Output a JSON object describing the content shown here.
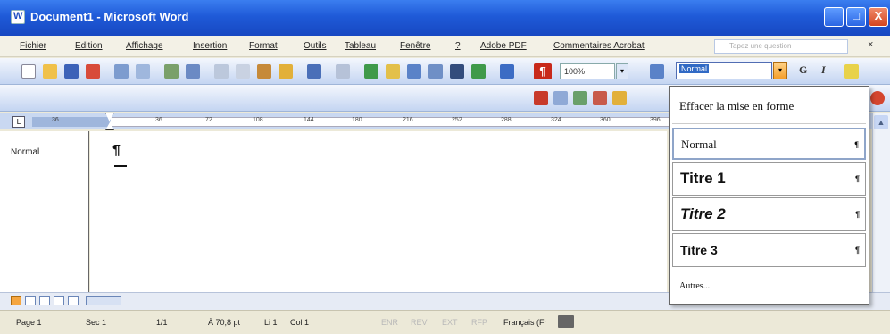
{
  "window": {
    "title": "Document1 - Microsoft Word",
    "minimize_glyph": "_",
    "maximize_glyph": "□",
    "close_glyph": "X"
  },
  "menu": {
    "items": [
      "Fichier",
      "Edition",
      "Affichage",
      "Insertion",
      "Format",
      "Outils",
      "Tableau",
      "Fenêtre",
      "?",
      "Adobe PDF",
      "Commentaires Acrobat"
    ],
    "ask_placeholder": "Tapez une question",
    "ask_close": "×"
  },
  "toolbar": {
    "zoom_value": "100%",
    "zoom_arrow": "▾",
    "pilcrow_button": "¶",
    "style_value": "Normal",
    "style_arrow": "▾",
    "bold_label": "G",
    "italic_label": "I"
  },
  "ruler": {
    "tab_selector": "L",
    "labels": [
      "36",
      "36",
      "72",
      "108",
      "144",
      "180",
      "216",
      "252",
      "288",
      "324",
      "360",
      "396"
    ]
  },
  "document": {
    "style_area_label": "Normal",
    "paragraph_mark": "¶"
  },
  "scrollbar": {
    "up_arrow": "▲"
  },
  "status": {
    "page": "Page 1",
    "section": "Sec 1",
    "pages": "1/1",
    "position": "À 70,8 pt",
    "line": "Li 1",
    "column": "Col 1",
    "rec": "ENR",
    "rev": "REV",
    "ext": "EXT",
    "ovr": "RFP",
    "language": "Français (Fr"
  },
  "style_dropdown": {
    "clear_label": "Effacer la mise en forme",
    "items": [
      {
        "label": "Normal",
        "mark": "¶"
      },
      {
        "label": "Titre 1",
        "mark": "¶"
      },
      {
        "label": "Titre 2",
        "mark": "¶"
      },
      {
        "label": "Titre 3",
        "mark": "¶"
      }
    ],
    "more_label": "Autres..."
  },
  "colors": {
    "titlebar": "#1f5ad8",
    "toolbar": "#c4d5f2",
    "accent": "#f59d2a"
  }
}
